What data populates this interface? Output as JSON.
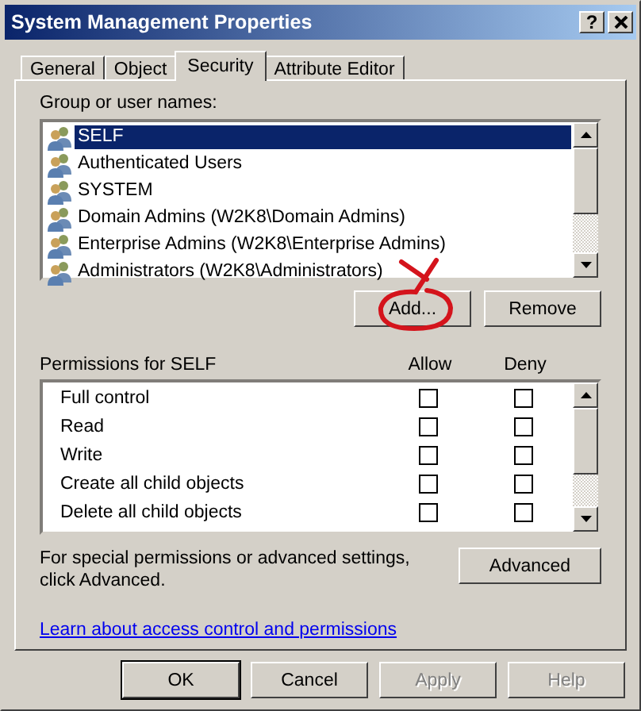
{
  "window": {
    "title": "System Management Properties",
    "help_button": "?"
  },
  "tabs": [
    {
      "label": "General",
      "selected": false
    },
    {
      "label": "Object",
      "selected": false
    },
    {
      "label": "Security",
      "selected": true
    },
    {
      "label": "Attribute Editor",
      "selected": false
    }
  ],
  "users": {
    "label": "Group or user names:",
    "items": [
      {
        "name": "SELF",
        "selected": true
      },
      {
        "name": "Authenticated Users",
        "selected": false
      },
      {
        "name": "SYSTEM",
        "selected": false
      },
      {
        "name": "Domain Admins (W2K8\\Domain Admins)",
        "selected": false
      },
      {
        "name": "Enterprise Admins (W2K8\\Enterprise Admins)",
        "selected": false
      },
      {
        "name": "Administrators (W2K8\\Administrators)",
        "selected": false
      }
    ],
    "buttons": [
      "Add...",
      "Remove"
    ]
  },
  "permissions": {
    "label": "Permissions for SELF",
    "columns": [
      "Allow",
      "Deny"
    ],
    "rows": [
      {
        "name": "Full control",
        "allow": false,
        "deny": false
      },
      {
        "name": "Read",
        "allow": false,
        "deny": false
      },
      {
        "name": "Write",
        "allow": false,
        "deny": false
      },
      {
        "name": "Create all child objects",
        "allow": false,
        "deny": false
      },
      {
        "name": "Delete all child objects",
        "allow": false,
        "deny": false
      }
    ]
  },
  "advanced": {
    "note": "For special permissions or advanced settings, click Advanced.",
    "button": "Advanced"
  },
  "link": "Learn about access control and permissions",
  "dialog_buttons": [
    {
      "label": "OK",
      "default": true,
      "disabled": false
    },
    {
      "label": "Cancel",
      "default": false,
      "disabled": false
    },
    {
      "label": "Apply",
      "default": false,
      "disabled": true
    },
    {
      "label": "Help",
      "default": false,
      "disabled": true
    }
  ]
}
